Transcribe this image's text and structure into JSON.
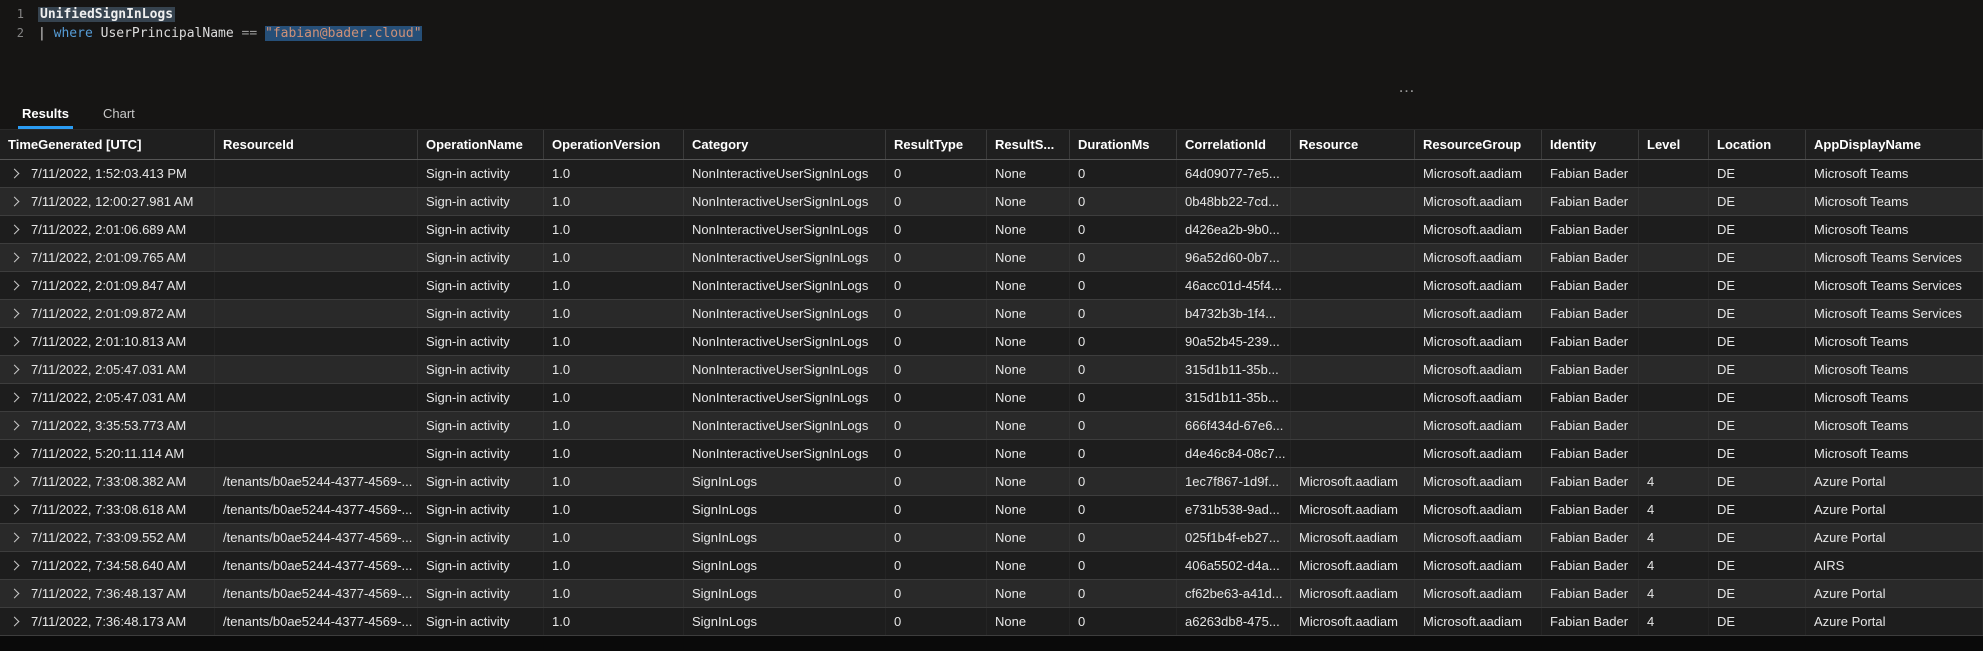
{
  "editor": {
    "lines": [
      {
        "number": "1",
        "segments": [
          {
            "cls": "tok-table",
            "text": "UnifiedSignInLogs"
          }
        ]
      },
      {
        "number": "2",
        "segments": [
          {
            "cls": "tok-pipe",
            "text": "| "
          },
          {
            "cls": "tok-keyword",
            "text": "where"
          },
          {
            "cls": "tok-ident",
            "text": " UserPrincipalName "
          },
          {
            "cls": "tok-op",
            "text": "== "
          },
          {
            "cls": "tok-string sel",
            "text": "\"fabian@bader.cloud\""
          }
        ]
      }
    ]
  },
  "splitter": {
    "handle_icon": "…"
  },
  "tabs": [
    {
      "label": "Results",
      "active": true
    },
    {
      "label": "Chart",
      "active": false
    }
  ],
  "table": {
    "columns": [
      "TimeGenerated [UTC]",
      "ResourceId",
      "OperationName",
      "OperationVersion",
      "Category",
      "ResultType",
      "ResultS...",
      "DurationMs",
      "CorrelationId",
      "Resource",
      "ResourceGroup",
      "Identity",
      "Level",
      "Location",
      "AppDisplayName"
    ],
    "rows": [
      [
        "7/11/2022, 1:52:03.413 PM",
        "",
        "Sign-in activity",
        "1.0",
        "NonInteractiveUserSignInLogs",
        "0",
        "None",
        "0",
        "64d09077-7e5...",
        "",
        "Microsoft.aadiam",
        "Fabian Bader",
        "",
        "DE",
        "Microsoft Teams"
      ],
      [
        "7/11/2022, 12:00:27.981 AM",
        "",
        "Sign-in activity",
        "1.0",
        "NonInteractiveUserSignInLogs",
        "0",
        "None",
        "0",
        "0b48bb22-7cd...",
        "",
        "Microsoft.aadiam",
        "Fabian Bader",
        "",
        "DE",
        "Microsoft Teams"
      ],
      [
        "7/11/2022, 2:01:06.689 AM",
        "",
        "Sign-in activity",
        "1.0",
        "NonInteractiveUserSignInLogs",
        "0",
        "None",
        "0",
        "d426ea2b-9b0...",
        "",
        "Microsoft.aadiam",
        "Fabian Bader",
        "",
        "DE",
        "Microsoft Teams"
      ],
      [
        "7/11/2022, 2:01:09.765 AM",
        "",
        "Sign-in activity",
        "1.0",
        "NonInteractiveUserSignInLogs",
        "0",
        "None",
        "0",
        "96a52d60-0b7...",
        "",
        "Microsoft.aadiam",
        "Fabian Bader",
        "",
        "DE",
        "Microsoft Teams Services"
      ],
      [
        "7/11/2022, 2:01:09.847 AM",
        "",
        "Sign-in activity",
        "1.0",
        "NonInteractiveUserSignInLogs",
        "0",
        "None",
        "0",
        "46acc01d-45f4...",
        "",
        "Microsoft.aadiam",
        "Fabian Bader",
        "",
        "DE",
        "Microsoft Teams Services"
      ],
      [
        "7/11/2022, 2:01:09.872 AM",
        "",
        "Sign-in activity",
        "1.0",
        "NonInteractiveUserSignInLogs",
        "0",
        "None",
        "0",
        "b4732b3b-1f4...",
        "",
        "Microsoft.aadiam",
        "Fabian Bader",
        "",
        "DE",
        "Microsoft Teams Services"
      ],
      [
        "7/11/2022, 2:01:10.813 AM",
        "",
        "Sign-in activity",
        "1.0",
        "NonInteractiveUserSignInLogs",
        "0",
        "None",
        "0",
        "90a52b45-239...",
        "",
        "Microsoft.aadiam",
        "Fabian Bader",
        "",
        "DE",
        "Microsoft Teams"
      ],
      [
        "7/11/2022, 2:05:47.031 AM",
        "",
        "Sign-in activity",
        "1.0",
        "NonInteractiveUserSignInLogs",
        "0",
        "None",
        "0",
        "315d1b11-35b...",
        "",
        "Microsoft.aadiam",
        "Fabian Bader",
        "",
        "DE",
        "Microsoft Teams"
      ],
      [
        "7/11/2022, 2:05:47.031 AM",
        "",
        "Sign-in activity",
        "1.0",
        "NonInteractiveUserSignInLogs",
        "0",
        "None",
        "0",
        "315d1b11-35b...",
        "",
        "Microsoft.aadiam",
        "Fabian Bader",
        "",
        "DE",
        "Microsoft Teams"
      ],
      [
        "7/11/2022, 3:35:53.773 AM",
        "",
        "Sign-in activity",
        "1.0",
        "NonInteractiveUserSignInLogs",
        "0",
        "None",
        "0",
        "666f434d-67e6...",
        "",
        "Microsoft.aadiam",
        "Fabian Bader",
        "",
        "DE",
        "Microsoft Teams"
      ],
      [
        "7/11/2022, 5:20:11.114 AM",
        "",
        "Sign-in activity",
        "1.0",
        "NonInteractiveUserSignInLogs",
        "0",
        "None",
        "0",
        "d4e46c84-08c7...",
        "",
        "Microsoft.aadiam",
        "Fabian Bader",
        "",
        "DE",
        "Microsoft Teams"
      ],
      [
        "7/11/2022, 7:33:08.382 AM",
        "/tenants/b0ae5244-4377-4569-...",
        "Sign-in activity",
        "1.0",
        "SignInLogs",
        "0",
        "None",
        "0",
        "1ec7f867-1d9f...",
        "Microsoft.aadiam",
        "Microsoft.aadiam",
        "Fabian Bader",
        "4",
        "DE",
        "Azure Portal"
      ],
      [
        "7/11/2022, 7:33:08.618 AM",
        "/tenants/b0ae5244-4377-4569-...",
        "Sign-in activity",
        "1.0",
        "SignInLogs",
        "0",
        "None",
        "0",
        "e731b538-9ad...",
        "Microsoft.aadiam",
        "Microsoft.aadiam",
        "Fabian Bader",
        "4",
        "DE",
        "Azure Portal"
      ],
      [
        "7/11/2022, 7:33:09.552 AM",
        "/tenants/b0ae5244-4377-4569-...",
        "Sign-in activity",
        "1.0",
        "SignInLogs",
        "0",
        "None",
        "0",
        "025f1b4f-eb27...",
        "Microsoft.aadiam",
        "Microsoft.aadiam",
        "Fabian Bader",
        "4",
        "DE",
        "Azure Portal"
      ],
      [
        "7/11/2022, 7:34:58.640 AM",
        "/tenants/b0ae5244-4377-4569-...",
        "Sign-in activity",
        "1.0",
        "SignInLogs",
        "0",
        "None",
        "0",
        "406a5502-d4a...",
        "Microsoft.aadiam",
        "Microsoft.aadiam",
        "Fabian Bader",
        "4",
        "DE",
        "AIRS"
      ],
      [
        "7/11/2022, 7:36:48.137 AM",
        "/tenants/b0ae5244-4377-4569-...",
        "Sign-in activity",
        "1.0",
        "SignInLogs",
        "0",
        "None",
        "0",
        "cf62be63-a41d...",
        "Microsoft.aadiam",
        "Microsoft.aadiam",
        "Fabian Bader",
        "4",
        "DE",
        "Azure Portal"
      ],
      [
        "7/11/2022, 7:36:48.173 AM",
        "/tenants/b0ae5244-4377-4569-...",
        "Sign-in activity",
        "1.0",
        "SignInLogs",
        "0",
        "None",
        "0",
        "a6263db8-475...",
        "Microsoft.aadiam",
        "Microsoft.aadiam",
        "Fabian Bader",
        "4",
        "DE",
        "Azure Portal"
      ]
    ]
  },
  "colors": {
    "accent_blue": "#2b9cf2",
    "keyword_blue": "#569cd6",
    "string_orange": "#ce9178",
    "selection_blue": "#264f78"
  }
}
